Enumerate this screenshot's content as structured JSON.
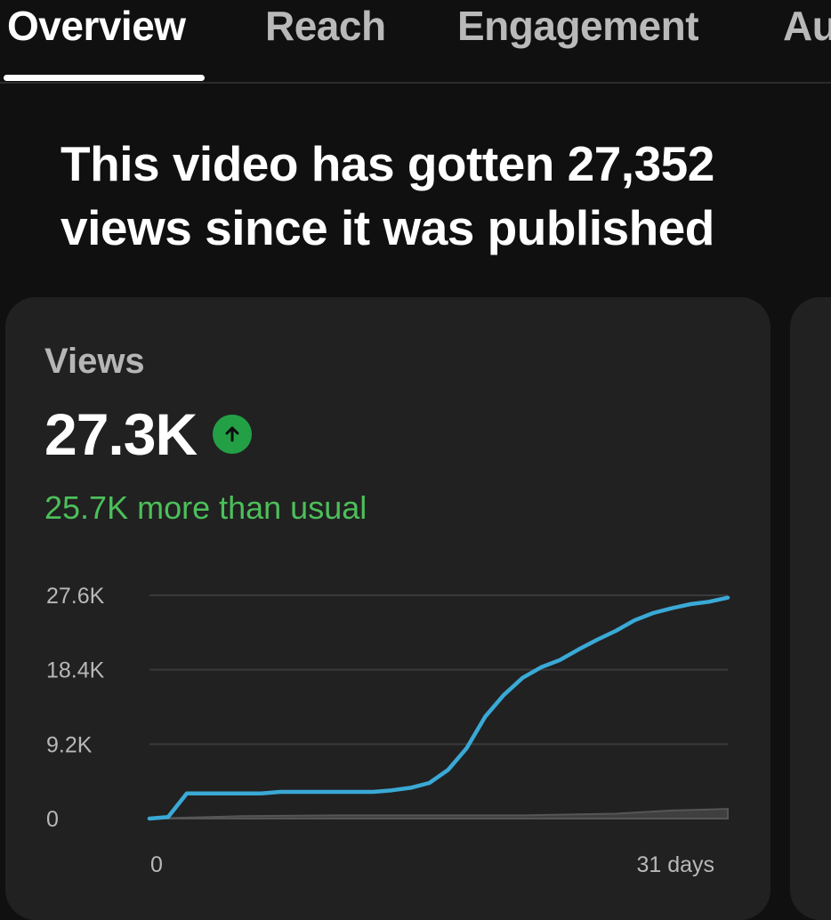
{
  "tabs": [
    {
      "label": "Overview",
      "active": true
    },
    {
      "label": "Reach",
      "active": false
    },
    {
      "label": "Engagement",
      "active": false
    },
    {
      "label": "Au",
      "active": false
    }
  ],
  "headline": {
    "line1": "This video has gotten 27,352",
    "line2": "views since it was published"
  },
  "views_card": {
    "label": "Views",
    "value": "27.3K",
    "trend_icon": "arrow-up-icon",
    "delta_text": "25.7K more than usual"
  },
  "colors": {
    "accent_line": "#3aa9d6",
    "baseline_area": "#4a4a4a",
    "positive": "#4cbf5a",
    "badge": "#23a046"
  },
  "chart_data": {
    "type": "line",
    "y_tick_labels": [
      "27.6K",
      "18.4K",
      "9.2K",
      "0"
    ],
    "y_ticks": [
      27600,
      18400,
      9200,
      0
    ],
    "x_tick_labels": [
      "0",
      "31 days"
    ],
    "xlim": [
      0,
      31
    ],
    "ylim": [
      0,
      27600
    ],
    "grid": true,
    "series": [
      {
        "x": [
          0,
          1,
          2,
          3,
          4,
          5,
          6,
          7,
          8,
          9,
          10,
          11,
          12,
          13,
          14,
          15,
          16,
          17,
          18,
          19,
          20,
          21,
          22,
          23,
          24,
          25,
          26,
          27,
          28,
          29,
          30,
          31
        ],
        "values": [
          0,
          200,
          3100,
          3100,
          3100,
          3100,
          3100,
          3300,
          3300,
          3300,
          3300,
          3300,
          3300,
          3500,
          3800,
          4400,
          6000,
          8700,
          12600,
          15300,
          17400,
          18700,
          19600,
          20900,
          22100,
          23200,
          24500,
          25400,
          26000,
          26500,
          26800,
          27300
        ]
      },
      {
        "x": [
          0,
          5,
          10,
          15,
          20,
          25,
          28,
          31
        ],
        "values": [
          0,
          300,
          400,
          400,
          400,
          600,
          1000,
          1200
        ]
      }
    ]
  }
}
